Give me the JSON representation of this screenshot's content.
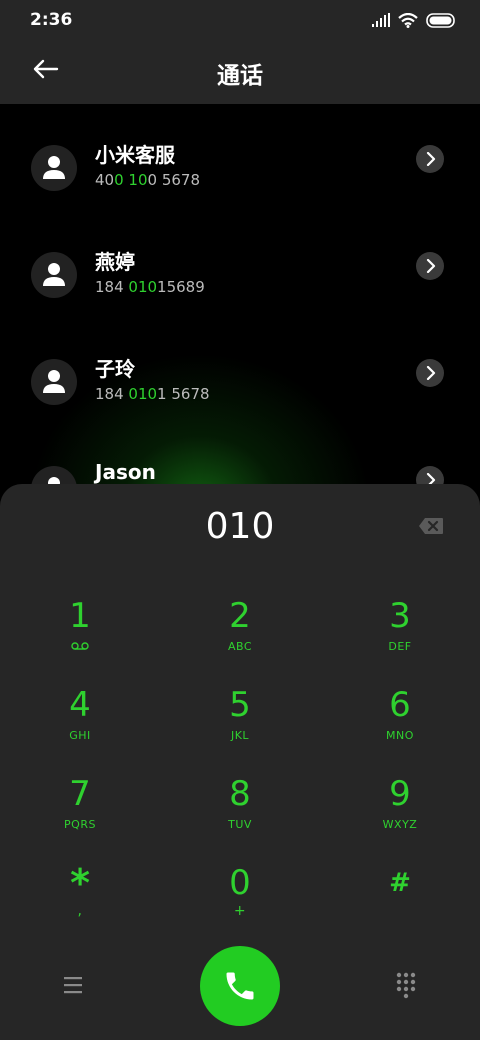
{
  "status_bar": {
    "time": "2:36"
  },
  "header": {
    "title": "通话"
  },
  "contacts": [
    {
      "name": "小米客服",
      "number": {
        "pre": "40",
        "hl1": "0",
        "mid": " ",
        "hl2": "10",
        "post": "0 5678"
      }
    },
    {
      "name": "燕婷",
      "number": {
        "pre": "184 ",
        "hl1": "010",
        "mid": "",
        "hl2": "",
        "post": "15689"
      }
    },
    {
      "name": "子玲",
      "number": {
        "pre": "184 ",
        "hl1": "010",
        "mid": "",
        "hl2": "",
        "post": "1 5678"
      }
    },
    {
      "name": "Jason",
      "number": {
        "pre": "",
        "hl1": "",
        "mid": "",
        "hl2": "",
        "post": ""
      }
    }
  ],
  "dialpad": {
    "display": "010",
    "keys": [
      {
        "digit": "1",
        "letters": "voicemail-icon"
      },
      {
        "digit": "2",
        "letters": "ABC"
      },
      {
        "digit": "3",
        "letters": "DEF"
      },
      {
        "digit": "4",
        "letters": "GHI"
      },
      {
        "digit": "5",
        "letters": "JKL"
      },
      {
        "digit": "6",
        "letters": "MNO"
      },
      {
        "digit": "7",
        "letters": "PQRS"
      },
      {
        "digit": "8",
        "letters": "TUV"
      },
      {
        "digit": "9",
        "letters": "WXYZ"
      },
      {
        "digit": "*",
        "letters": ","
      },
      {
        "digit": "0",
        "letters": "+"
      },
      {
        "digit": "#",
        "letters": ""
      }
    ]
  },
  "colors": {
    "accent": "#2fd12f",
    "call_button": "#22cc22",
    "panel": "#262626",
    "background": "#000000"
  }
}
